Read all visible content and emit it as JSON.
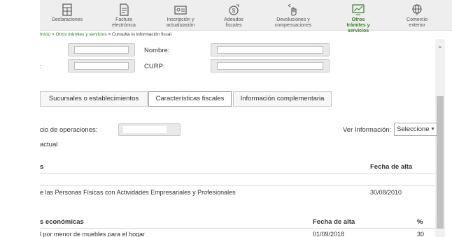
{
  "nav": {
    "items": [
      {
        "label": "Declaraciones",
        "icon": "calculator-icon"
      },
      {
        "label": "Factura electrónica",
        "icon": "invoice-icon"
      },
      {
        "label": "Inscripción y actualización",
        "icon": "id-card-icon"
      },
      {
        "label": "Adeudos fiscales",
        "icon": "money-icon"
      },
      {
        "label": "Devoluciones y compensaciones",
        "icon": "hand-icon"
      },
      {
        "label": "Otros trámites y servicios",
        "icon": "monitor-chart-icon",
        "active": true
      },
      {
        "label": "Comercio exterior",
        "icon": "globe-icon"
      }
    ],
    "active_color": "#3a7d2c"
  },
  "breadcrumb": {
    "home": "Inicio",
    "sep1": " > ",
    "section": "Otros trámites y servicios",
    "sep2": " > ",
    "current": "Consulta tu información fiscal"
  },
  "form": {
    "nombre_label": "Nombre:",
    "curp_label": "CURP:",
    "left_colon": ":"
  },
  "tabs": [
    {
      "label": "Sucursales o establecimientos"
    },
    {
      "label": "Características fiscales",
      "active": true
    },
    {
      "label": "Información complementaria"
    }
  ],
  "details": {
    "inicio_label": "cio de operaciones:",
    "actual_label": "actual",
    "ver_info_label": "Ver Información:",
    "ver_info_value": "Seleccione"
  },
  "regimen_table": {
    "headers": [
      "s",
      "Fecha de alta"
    ],
    "rows": [
      [
        "e las Personas Físicas con Actividades Empresariales y Profesionales",
        "30/08/2010"
      ]
    ]
  },
  "actividades_table": {
    "headers": [
      "s económicas",
      "Fecha de alta",
      "%"
    ],
    "rows": [
      [
        "l por menor de muebles para el hogar",
        "01/09/2018",
        "30"
      ]
    ]
  },
  "colors": {
    "accent": "#3a7d2c",
    "nav_bg": "#eeeeee"
  }
}
